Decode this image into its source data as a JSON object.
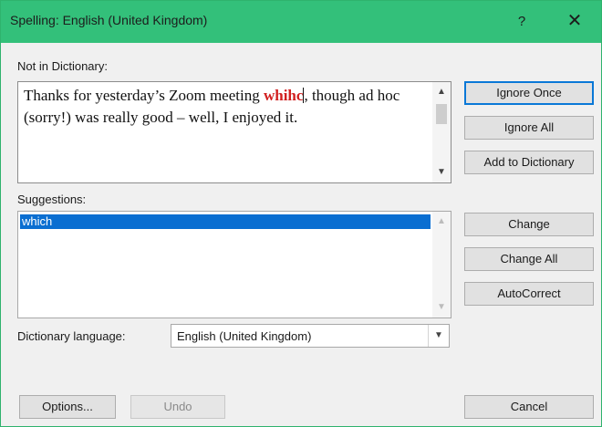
{
  "window": {
    "title": "Spelling: English (United Kingdom)",
    "help_glyph": "?",
    "close_glyph": "✕"
  },
  "not_in_dictionary": {
    "label": "Not in Dictionary:",
    "text_before": "Thanks for yesterday’s Zoom meeting ",
    "misspelled_word": "whihc",
    "text_after": ", though ad hoc (sorry!) was really good – well, I enjoyed it.",
    "misspelled_color": "#d11f1f"
  },
  "suggestions": {
    "label": "Suggestions:",
    "items": [
      "which"
    ],
    "selected_index": 0,
    "selection_color": "#0a6ed1"
  },
  "dictionary_language": {
    "label": "Dictionary language:",
    "value": "English (United Kingdom)"
  },
  "buttons": {
    "ignore_once": "Ignore Once",
    "ignore_all": "Ignore All",
    "add_to_dictionary": "Add to Dictionary",
    "change": "Change",
    "change_all": "Change All",
    "autocorrect": "AutoCorrect",
    "options": "Options...",
    "undo": "Undo",
    "cancel": "Cancel"
  },
  "icons": {
    "scroll_up": "▲",
    "scroll_down": "▼",
    "dropdown": "▼"
  },
  "colors": {
    "titlebar": "#33c07a",
    "default_button_border": "#0a78d7"
  }
}
